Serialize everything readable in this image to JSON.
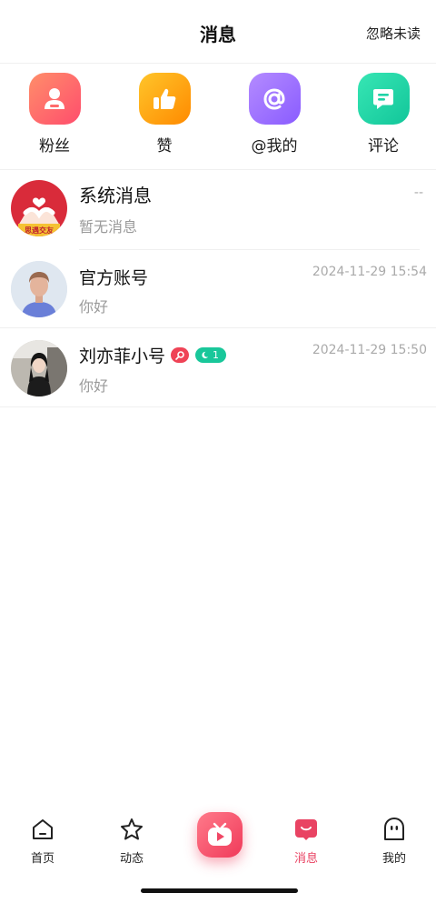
{
  "header": {
    "title": "消息",
    "ignore_unread": "忽略未读"
  },
  "quick_actions": [
    {
      "label": "粉丝",
      "icon": "person-icon",
      "color": "#ff5f6d"
    },
    {
      "label": "赞",
      "icon": "thumbs-up-icon",
      "color": "#ffa312"
    },
    {
      "label": "@我的",
      "icon": "at-icon",
      "color": "#9b6bff"
    },
    {
      "label": "评论",
      "icon": "comment-icon",
      "color": "#1fd3a6"
    }
  ],
  "messages": [
    {
      "name": "系统消息",
      "preview": "暂无消息",
      "time": "--",
      "avatar_caption": "思遇交友",
      "avatar": "system-avatar"
    },
    {
      "name": "官方账号",
      "preview": "你好",
      "time": "2024-11-29 15:54",
      "avatar": "official-avatar"
    },
    {
      "name": "刘亦菲小号",
      "preview": "你好",
      "time": "2024-11-29 15:50",
      "level_badge": "1",
      "avatar": "user-photo-avatar"
    }
  ],
  "tabbar": {
    "items": [
      {
        "label": "首页",
        "icon": "home-icon"
      },
      {
        "label": "动态",
        "icon": "star-icon"
      },
      {
        "label": "",
        "icon": "tv-play-icon"
      },
      {
        "label": "消息",
        "icon": "message-icon",
        "active": true
      },
      {
        "label": "我的",
        "icon": "ghost-icon"
      }
    ],
    "active_color": "#e94363"
  }
}
